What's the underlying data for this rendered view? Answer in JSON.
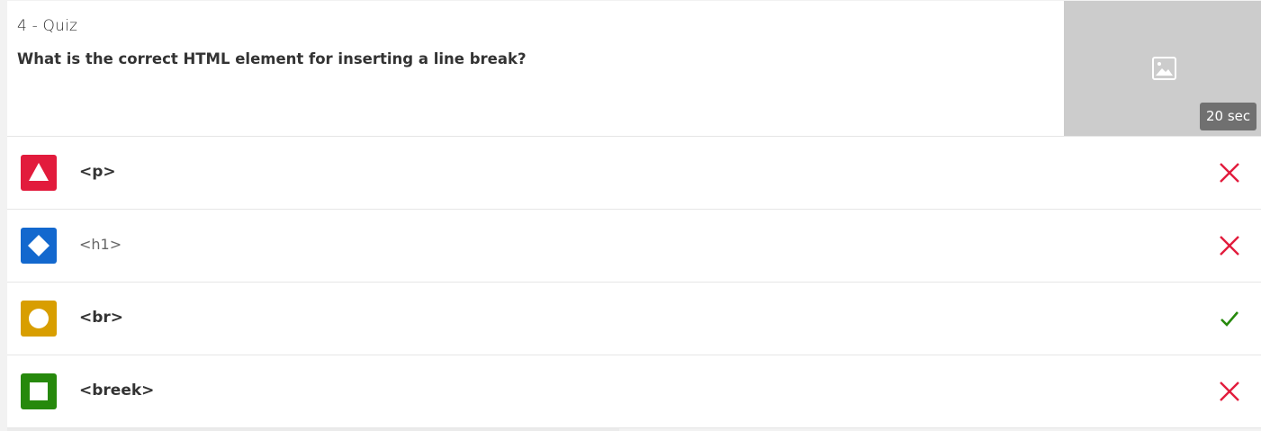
{
  "question": {
    "index_label": "4 - Quiz",
    "text": "What is the correct HTML element for inserting a line break?",
    "media_icon": "image-placeholder-icon",
    "time_label": "20 sec"
  },
  "options": [
    {
      "label": "<p>",
      "shape": "triangle",
      "color": "#e21b3c",
      "correct": false,
      "status_icon": "cross-icon"
    },
    {
      "label": "<h1>",
      "shape": "diamond",
      "color": "#1368ce",
      "correct": false,
      "status_icon": "cross-icon"
    },
    {
      "label": "<br>",
      "shape": "circle",
      "color": "#d89e00",
      "correct": true,
      "status_icon": "check-icon"
    },
    {
      "label": "<breek>",
      "shape": "square",
      "color": "#26890c",
      "correct": false,
      "status_icon": "cross-icon"
    }
  ],
  "colors": {
    "wrong": "#e21b3c",
    "correct": "#26890c",
    "media_bg": "#cccccc",
    "badge_bg": "#707070"
  }
}
